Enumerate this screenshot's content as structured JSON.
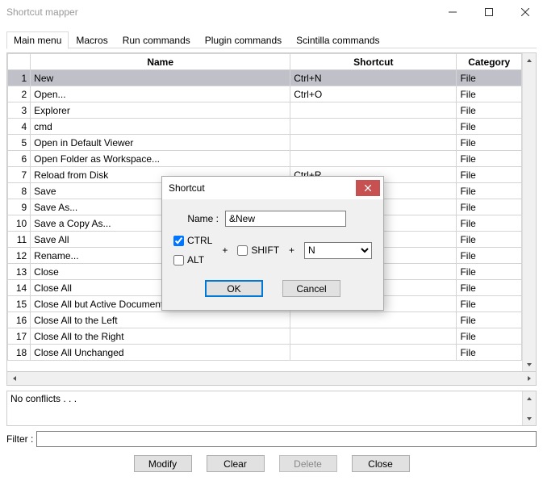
{
  "window": {
    "title": "Shortcut mapper"
  },
  "tabs": [
    "Main menu",
    "Macros",
    "Run commands",
    "Plugin commands",
    "Scintilla commands"
  ],
  "active_tab": 0,
  "columns": {
    "name": "Name",
    "shortcut": "Shortcut",
    "category": "Category"
  },
  "rows": [
    {
      "n": 1,
      "name": "New",
      "shortcut": "Ctrl+N",
      "category": "File",
      "selected": true
    },
    {
      "n": 2,
      "name": "Open...",
      "shortcut": "Ctrl+O",
      "category": "File"
    },
    {
      "n": 3,
      "name": "Explorer",
      "shortcut": "",
      "category": "File"
    },
    {
      "n": 4,
      "name": "cmd",
      "shortcut": "",
      "category": "File"
    },
    {
      "n": 5,
      "name": "Open in Default Viewer",
      "shortcut": "",
      "category": "File"
    },
    {
      "n": 6,
      "name": "Open Folder as Workspace...",
      "shortcut": "",
      "category": "File"
    },
    {
      "n": 7,
      "name": "Reload from Disk",
      "shortcut": "Ctrl+R",
      "category": "File"
    },
    {
      "n": 8,
      "name": "Save",
      "shortcut": "",
      "category": "File"
    },
    {
      "n": 9,
      "name": "Save As...",
      "shortcut": "",
      "category": "File"
    },
    {
      "n": 10,
      "name": "Save a Copy As...",
      "shortcut": "",
      "category": "File"
    },
    {
      "n": 11,
      "name": "Save All",
      "shortcut": "",
      "category": "File"
    },
    {
      "n": 12,
      "name": "Rename...",
      "shortcut": "",
      "category": "File"
    },
    {
      "n": 13,
      "name": "Close",
      "shortcut": "",
      "category": "File"
    },
    {
      "n": 14,
      "name": "Close All",
      "shortcut": "",
      "category": "File"
    },
    {
      "n": 15,
      "name": "Close All but Active Document",
      "shortcut": "",
      "category": "File"
    },
    {
      "n": 16,
      "name": "Close All to the Left",
      "shortcut": "",
      "category": "File"
    },
    {
      "n": 17,
      "name": "Close All to the Right",
      "shortcut": "",
      "category": "File"
    },
    {
      "n": 18,
      "name": "Close All Unchanged",
      "shortcut": "",
      "category": "File"
    }
  ],
  "conflicts_text": "No conflicts . . .",
  "filter_label": "Filter :",
  "filter_value": "",
  "buttons": {
    "modify": "Modify",
    "clear": "Clear",
    "delete": "Delete",
    "close": "Close"
  },
  "dialog": {
    "title": "Shortcut",
    "name_label": "Name :",
    "name_value": "&New",
    "ctrl_label": "CTRL",
    "alt_label": "ALT",
    "shift_label": "SHIFT",
    "ctrl_checked": true,
    "alt_checked": false,
    "shift_checked": false,
    "plus": "+",
    "key_value": "N",
    "ok": "OK",
    "cancel": "Cancel"
  }
}
